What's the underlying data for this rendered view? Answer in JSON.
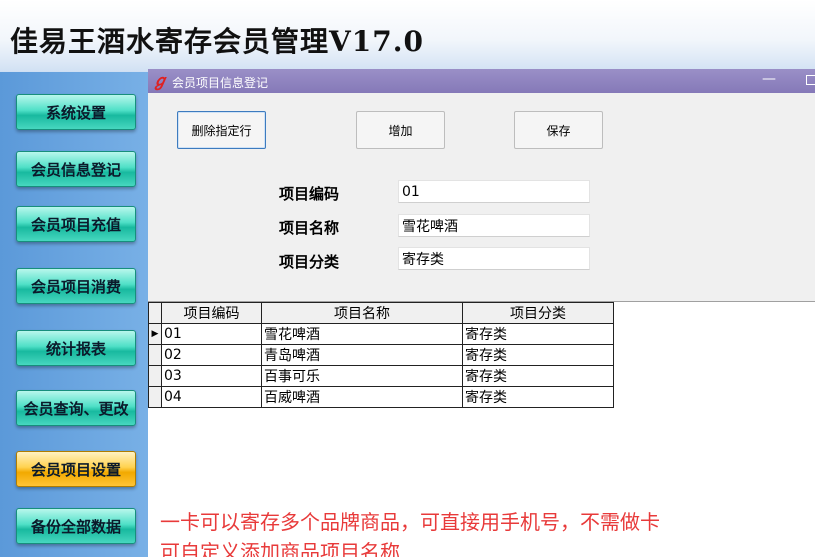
{
  "app": {
    "title": "佳易王酒水寄存会员管理V17.0"
  },
  "sidebar": {
    "items": [
      {
        "label": "系统设置"
      },
      {
        "label": "会员信息登记"
      },
      {
        "label": "会员项目充值"
      },
      {
        "label": "会员项目消费"
      },
      {
        "label": "统计报表"
      },
      {
        "label": "会员查询、更改"
      },
      {
        "label": "会员项目设置"
      },
      {
        "label": "备份全部数据"
      }
    ],
    "active_index": 6
  },
  "window": {
    "title": "会员项目信息登记",
    "minimize_glyph": "—"
  },
  "toolbar": {
    "delete_label": "删除指定行",
    "add_label": "增加",
    "save_label": "保存"
  },
  "form": {
    "code_label": "项目编码",
    "code_value": "01",
    "name_label": "项目名称",
    "name_value": "雪花啤酒",
    "category_label": "项目分类",
    "category_value": "寄存类"
  },
  "grid": {
    "columns": [
      "项目编码",
      "项目名称",
      "项目分类"
    ],
    "current_row_marker": "▶",
    "rows": [
      [
        "01",
        "雪花啤酒",
        "寄存类"
      ],
      [
        "02",
        "青岛啤酒",
        "寄存类"
      ],
      [
        "03",
        "百事可乐",
        "寄存类"
      ],
      [
        "04",
        "百威啤酒",
        "寄存类"
      ]
    ]
  },
  "notes": {
    "line1": "一卡可以寄存多个品牌商品，可直接用手机号，不需做卡",
    "line2": "可自定义添加商品项目名称"
  },
  "colors": {
    "nav_button": "#2fcdb3",
    "nav_button_active": "#f7b713",
    "titlebar": "#8c80be",
    "note_text": "#e83a3a"
  }
}
